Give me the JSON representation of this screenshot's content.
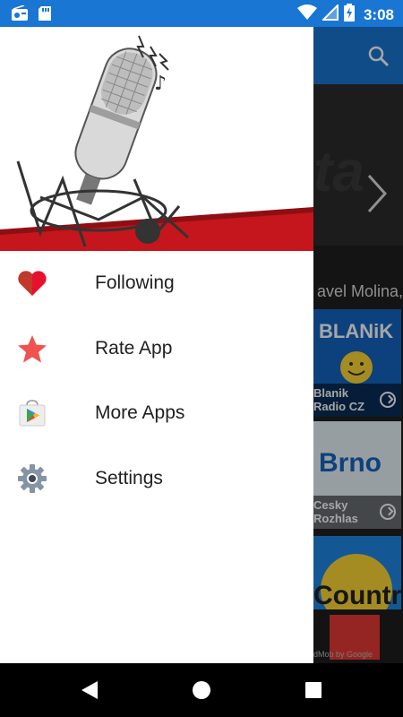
{
  "status_bar": {
    "time": "3:08",
    "icons": [
      "radio-icon",
      "sd-card-icon",
      "wifi-icon",
      "no-sim-icon",
      "battery-charging-icon"
    ],
    "background_color": "#1976d2"
  },
  "drawer": {
    "menu": [
      {
        "label": "Following",
        "icon": "heart-icon",
        "color": "#e8112d"
      },
      {
        "label": "Rate App",
        "icon": "star-icon",
        "color": "#ef5350"
      },
      {
        "label": "More Apps",
        "icon": "play-store-icon",
        "color": "#34a853"
      },
      {
        "label": "Settings",
        "icon": "gear-icon",
        "color": "#6b7b8c"
      }
    ]
  },
  "background_app": {
    "banner_caption": "avel Molina,",
    "stations": [
      {
        "name": "Blanik Radio CZ",
        "logo_text": "BLANiK"
      },
      {
        "name": "Cesky Rozhlas",
        "logo_text": "Brno"
      },
      {
        "name": "",
        "logo_text": "Country"
      }
    ],
    "ad_text": "dMob by Google",
    "accent_color": "#1976d2"
  },
  "nav_bar": {
    "buttons": [
      "back",
      "home",
      "recents"
    ]
  }
}
